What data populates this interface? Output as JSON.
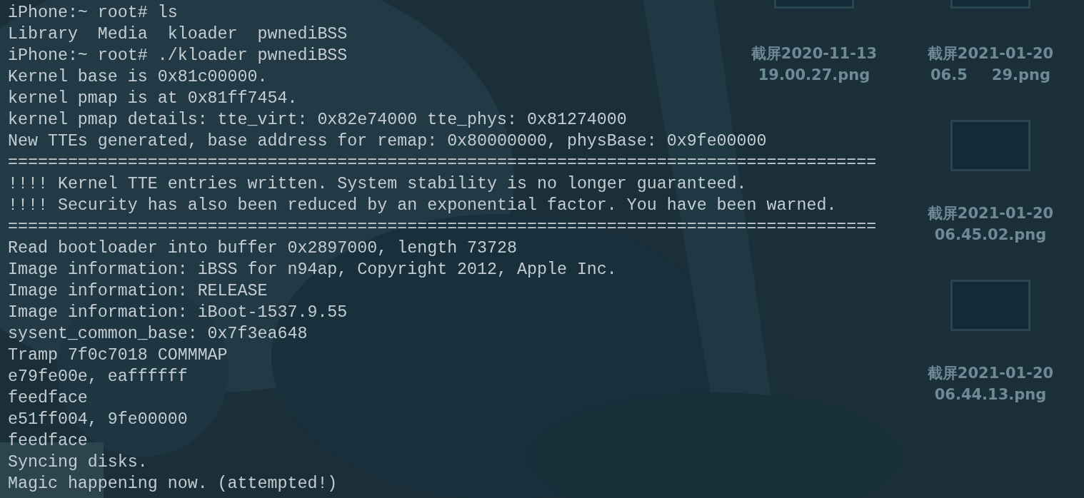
{
  "terminal": {
    "lines": [
      "iPhone:~ root# ls",
      "Library  Media  kloader  pwnediBSS",
      "iPhone:~ root# ./kloader pwnediBSS",
      "Kernel base is 0x81c00000.",
      "kernel pmap is at 0x81ff7454.",
      "kernel pmap details: tte_virt: 0x82e74000 tte_phys: 0x81274000",
      "New TTEs generated, base address for remap: 0x80000000, physBase: 0x9fe00000",
      "=======================================================================================",
      "!!!! Kernel TTE entries written. System stability is no longer guaranteed.",
      "!!!! Security has also been reduced by an exponential factor. You have been warned.",
      "=======================================================================================",
      "Read bootloader into buffer 0x2897000, length 73728",
      "Image information: iBSS for n94ap, Copyright 2012, Apple Inc.",
      "Image information: RELEASE",
      "Image information: iBoot-1537.9.55",
      "sysent_common_base: 0x7f3ea648",
      "Tramp 7f0c7018 COMMMAP",
      "e79fe00e, eaffffff",
      "feedface",
      "e51ff004, 9fe00000",
      "feedface",
      "Syncing disks.",
      "Magic happening now. (attempted!)"
    ]
  },
  "desktop_icons": [
    {
      "name_lines": [
        [
          "截屏2020-11-13"
        ],
        [
          "19.00.27.png"
        ]
      ]
    },
    {
      "name_lines": [
        [
          "截屏2021-01-20"
        ],
        [
          "06.5",
          "29.png"
        ]
      ]
    },
    {
      "name_lines": [
        [
          "截屏2021-01-20"
        ],
        [
          "06.45.02.png"
        ]
      ]
    },
    {
      "name_lines": [
        [
          "截屏2021-01-20"
        ],
        [
          "06.44.13.png"
        ]
      ]
    }
  ]
}
